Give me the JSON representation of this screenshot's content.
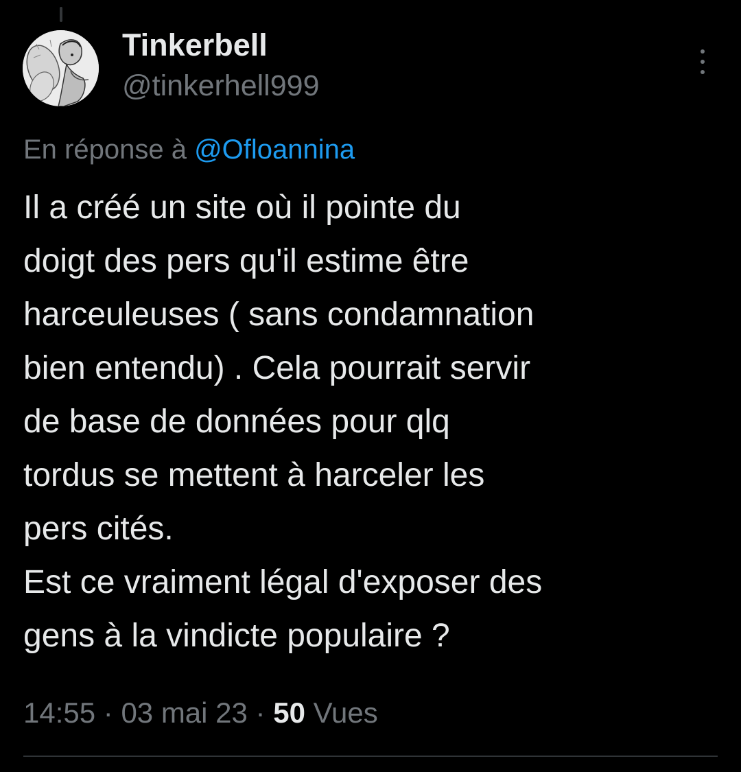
{
  "author": {
    "display_name": "Tinkerbell",
    "handle": "@tinkerhell999",
    "avatar": "tinkerbell-sketch-avatar"
  },
  "reply_context": {
    "prefix": "En réponse à ",
    "mention": "@Ofloannina"
  },
  "tweet": {
    "lines": [
      "Il a créé un site où il pointe du",
      "doigt des pers qu'il estime être",
      "harceuleuses ( sans condamnation",
      "bien entendu) . Cela pourrait servir",
      "de base de données pour qlq",
      "tordus se mettent à harceler les",
      "pers cités.",
      "Est ce vraiment légal d'exposer des",
      "gens à la vindicte populaire ?"
    ]
  },
  "meta": {
    "time": "14:55",
    "separator": " · ",
    "date": "03 mai 23",
    "views_count": "50",
    "views_label": " Vues"
  },
  "icons": {
    "more": "vertical-ellipsis-icon"
  },
  "colors": {
    "background": "#000000",
    "text_primary": "#e7e9ea",
    "text_secondary": "#71767b",
    "link": "#1d9bf0",
    "divider": "#2f3336"
  }
}
